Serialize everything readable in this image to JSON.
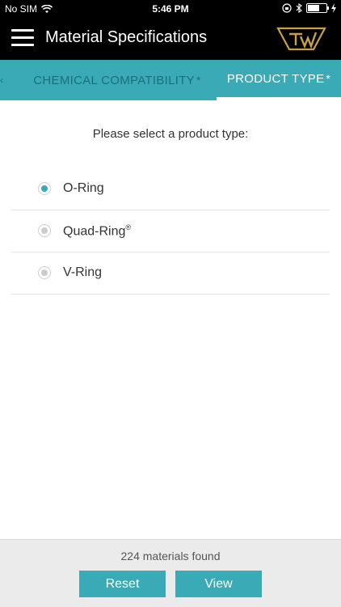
{
  "status": {
    "carrier": "No SIM",
    "time": "5:46 PM",
    "icons": [
      "wifi-icon",
      "orientation-lock-icon",
      "bluetooth-icon",
      "battery-icon",
      "charging-icon"
    ]
  },
  "nav": {
    "title": "Material Specifications",
    "logo_icon": "company-logo-icon"
  },
  "tabs": [
    {
      "label": "CHEMICAL COMPATIBILITY",
      "marker": "*",
      "active": false
    },
    {
      "label": "PRODUCT TYPE",
      "marker": "*",
      "active": true
    }
  ],
  "main": {
    "prompt": "Please select a product type:",
    "options": [
      {
        "label": "O-Ring",
        "superscript": "",
        "selected": true
      },
      {
        "label": "Quad-Ring",
        "superscript": "®",
        "selected": false
      },
      {
        "label": "V-Ring",
        "superscript": "",
        "selected": false
      }
    ]
  },
  "footer": {
    "count_text": "224 materials found",
    "reset_label": "Reset",
    "view_label": "View"
  },
  "colors": {
    "accent": "#3aaab7",
    "accent_dark_text": "#1b6f79",
    "header_bg": "#000000",
    "logo_gold": "#c9a04a"
  }
}
